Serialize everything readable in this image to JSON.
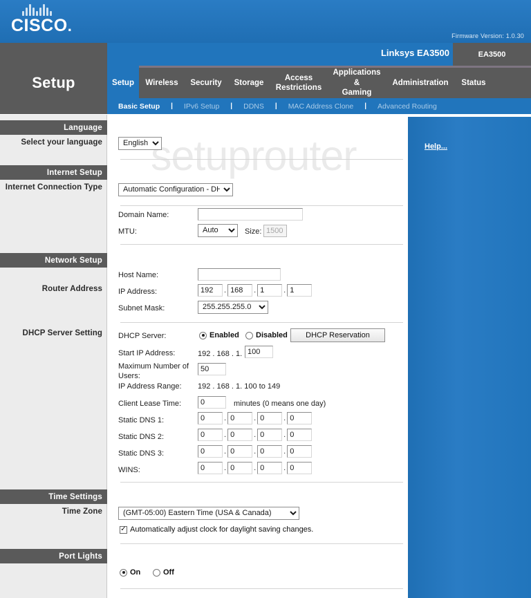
{
  "brand": {
    "name": "CISCO",
    "firmware": "Firmware Version: 1.0.30"
  },
  "header": {
    "page_title": "Setup",
    "model_name": "Linksys EA3500",
    "model_tab": "EA3500"
  },
  "tabs": [
    {
      "label": "Setup",
      "active": true
    },
    {
      "label": "Wireless",
      "active": false
    },
    {
      "label": "Security",
      "active": false
    },
    {
      "label": "Storage",
      "active": false
    },
    {
      "label": "Access\nRestrictions",
      "active": false
    },
    {
      "label": "Applications &\nGaming",
      "active": false
    },
    {
      "label": "Administration",
      "active": false
    },
    {
      "label": "Status",
      "active": false
    }
  ],
  "subnav": [
    {
      "label": "Basic Setup",
      "active": true
    },
    {
      "label": "IPv6 Setup",
      "active": false
    },
    {
      "label": "DDNS",
      "active": false
    },
    {
      "label": "MAC Address Clone",
      "active": false
    },
    {
      "label": "Advanced Routing",
      "active": false
    }
  ],
  "sidebar": {
    "language_head": "Language",
    "language_sub": "Select your language",
    "internet_head": "Internet Setup",
    "internet_sub": "Internet Connection Type",
    "network_head": "Network Setup",
    "router_address_sub": "Router Address",
    "dhcp_sub": "DHCP Server Setting",
    "time_head": "Time Settings",
    "time_sub": "Time Zone",
    "portlights_head": "Port Lights"
  },
  "form": {
    "language_value": "English",
    "connection_type_value": "Automatic Configuration - DHCP",
    "domain_name_label": "Domain Name:",
    "domain_name_value": "",
    "mtu_label": "MTU:",
    "mtu_value": "Auto",
    "size_label": "Size:",
    "size_value": "1500",
    "host_name_label": "Host Name:",
    "host_name_value": "",
    "ip_address_label": "IP Address:",
    "ip_octets": [
      "192",
      "168",
      "1",
      "1"
    ],
    "subnet_mask_label": "Subnet Mask:",
    "subnet_mask_value": "255.255.255.0",
    "dhcp_server_label": "DHCP Server:",
    "dhcp_enabled_label": "Enabled",
    "dhcp_disabled_label": "Disabled",
    "dhcp_selected": "Enabled",
    "dhcp_reservation_button": "DHCP Reservation",
    "start_ip_label": "Start IP  Address:",
    "start_ip_prefix": "192 . 168 . 1.",
    "start_ip_value": "100",
    "max_users_label": "Maximum Number of Users:",
    "max_users_value": "50",
    "ip_range_label": "IP Address Range:",
    "ip_range_value": "192 . 168 . 1. 100 to 149",
    "lease_time_label": "Client Lease Time:",
    "lease_time_value": "0",
    "lease_time_suffix": "minutes (0 means one day)",
    "static_dns_1_label": "Static DNS 1:",
    "static_dns_1": [
      "0",
      "0",
      "0",
      "0"
    ],
    "static_dns_2_label": "Static DNS 2:",
    "static_dns_2": [
      "0",
      "0",
      "0",
      "0"
    ],
    "static_dns_3_label": "Static DNS 3:",
    "static_dns_3": [
      "0",
      "0",
      "0",
      "0"
    ],
    "wins_label": "WINS:",
    "wins": [
      "0",
      "0",
      "0",
      "0"
    ],
    "time_zone_value": "(GMT-05:00) Eastern Time (USA & Canada)",
    "daylight_label": "Automatically adjust clock for daylight saving changes.",
    "daylight_checked": true,
    "port_on_label": "On",
    "port_off_label": "Off",
    "port_selected": "On"
  },
  "help": {
    "link_label": "Help..."
  },
  "watermark": {
    "text": "setuprouter"
  },
  "colors": {
    "cisco_blue": "#2175bc",
    "dark_gray": "#5a5a5a",
    "panel_gray": "#ececec"
  }
}
